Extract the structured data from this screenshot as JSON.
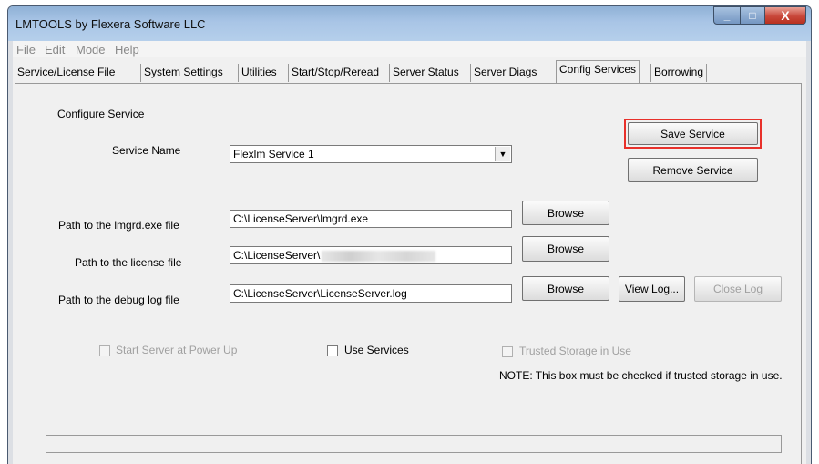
{
  "window": {
    "title": "LMTOOLS by Flexera Software LLC",
    "minimize": "_",
    "maximize": "□",
    "close": "X"
  },
  "menu": [
    "File",
    "Edit",
    "Mode",
    "Help"
  ],
  "tabs": [
    "Service/License File",
    "System Settings",
    "Utilities",
    "Start/Stop/Reread",
    "Server Status",
    "Server Diags",
    "Config Services",
    "Borrowing"
  ],
  "active_tab": "Config Services",
  "config": {
    "section_title": "Configure Service",
    "service_name_label": "Service Name",
    "service_name_value": "Flexlm Service 1",
    "lmgrd_label": "Path to the lmgrd.exe file",
    "lmgrd_value": "C:\\LicenseServer\\lmgrd.exe",
    "license_label": "Path to the license file",
    "license_value": "C:\\LicenseServer\\",
    "debug_label": "Path to the debug log file",
    "debug_value": "C:\\LicenseServer\\LicenseServer.log",
    "browse_label": "Browse",
    "save_service": "Save Service",
    "remove_service": "Remove Service",
    "view_log": "View Log...",
    "close_log": "Close Log"
  },
  "options": {
    "start_power_up": "Start Server at Power Up",
    "use_services": "Use Services",
    "trusted_storage": "Trusted Storage in Use",
    "note": "NOTE: This box must be checked if trusted storage in use."
  },
  "colors": {
    "highlight": "#e8302a",
    "titlebar": "#a9c5e6",
    "client": "#f0f0f0"
  }
}
